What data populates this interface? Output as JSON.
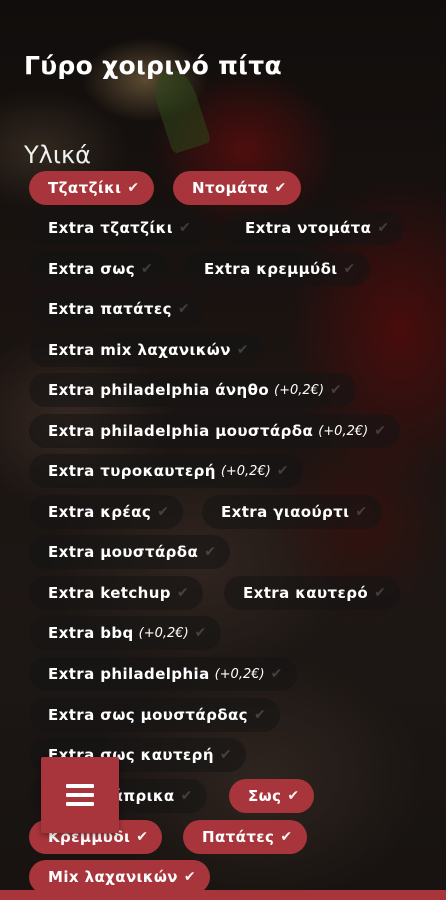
{
  "title": "Γύρο χοιρινό πίτα",
  "section_title": "Υλικά",
  "check_icon": "✔",
  "colors": {
    "accent": "#a8353b",
    "chip_bg": "rgba(20,20,20,0.55)",
    "text": "#ffffff"
  },
  "ingredients": [
    {
      "label": "Τζατζίκι",
      "price": "",
      "selected": true
    },
    {
      "label": "Ντομάτα",
      "price": "",
      "selected": true
    },
    {
      "label": "Extra τζατζίκι",
      "price": "",
      "selected": false
    },
    {
      "label": "Extra ντομάτα",
      "price": "",
      "selected": false
    },
    {
      "label": "Extra σως",
      "price": "",
      "selected": false
    },
    {
      "label": "Extra κρεμμύδι",
      "price": "",
      "selected": false
    },
    {
      "label": "Extra πατάτες",
      "price": "",
      "selected": false
    },
    {
      "label": "Extra mix λαχανικών",
      "price": "",
      "selected": false
    },
    {
      "label": "Extra philadelphia άνηθο",
      "price": "(+0,2€)",
      "selected": false
    },
    {
      "label": "Extra philadelphia μουστάρδα",
      "price": "(+0,2€)",
      "selected": false
    },
    {
      "label": "Extra τυροκαυτερή",
      "price": "(+0,2€)",
      "selected": false
    },
    {
      "label": "Extra κρέας",
      "price": "",
      "selected": false
    },
    {
      "label": "Extra γιαούρτι",
      "price": "",
      "selected": false
    },
    {
      "label": "Extra μουστάρδα",
      "price": "",
      "selected": false
    },
    {
      "label": "Extra ketchup",
      "price": "",
      "selected": false
    },
    {
      "label": "Extra καυτερό",
      "price": "",
      "selected": false
    },
    {
      "label": "Extra bbq",
      "price": "(+0,2€)",
      "selected": false
    },
    {
      "label": "Extra philadelphia",
      "price": "(+0,2€)",
      "selected": false
    },
    {
      "label": "Extra σως μουστάρδας",
      "price": "",
      "selected": false
    },
    {
      "label": "Extra σως καυτερή",
      "price": "",
      "selected": false
    },
    {
      "label": "Extra πάπρικα",
      "price": "",
      "selected": false
    },
    {
      "label": "Σως",
      "price": "",
      "selected": true
    },
    {
      "label": "Κρεμμύδι",
      "price": "",
      "selected": true
    },
    {
      "label": "Πατάτες",
      "price": "",
      "selected": true
    },
    {
      "label": "Mix λαχανικών",
      "price": "",
      "selected": true
    }
  ],
  "menu_button": {
    "icon": "hamburger-menu-icon"
  }
}
